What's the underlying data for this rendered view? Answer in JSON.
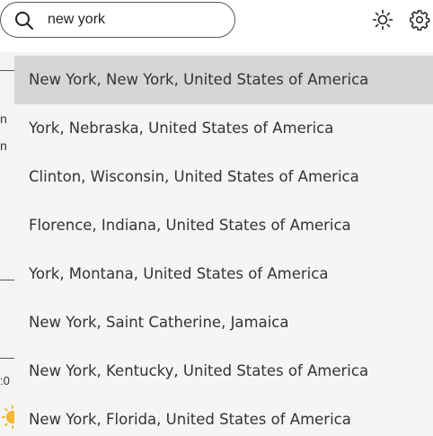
{
  "search": {
    "value": "new york",
    "placeholder": ""
  },
  "header_icons": [
    "sun-icon",
    "gear-icon"
  ],
  "background_fragments": {
    "line1": "n",
    "line2": "n",
    "time_fragment": ":0"
  },
  "suggestions": [
    {
      "label": "New York, New York, United States of America",
      "highlighted": true
    },
    {
      "label": "York, Nebraska, United States of America",
      "highlighted": false
    },
    {
      "label": "Clinton, Wisconsin, United States of America",
      "highlighted": false
    },
    {
      "label": "Florence, Indiana, United States of America",
      "highlighted": false
    },
    {
      "label": "York, Montana, United States of America",
      "highlighted": false
    },
    {
      "label": "New York, Saint Catherine, Jamaica",
      "highlighted": false
    },
    {
      "label": "New York, Kentucky, United States of America",
      "highlighted": false
    },
    {
      "label": "New York, Florida, United States of America",
      "highlighted": false
    }
  ],
  "colors": {
    "highlight": "#d6d6d8",
    "dropdown_bg": "#f5f5f5",
    "text": "#333333",
    "sun_accent": "#f2b632"
  }
}
